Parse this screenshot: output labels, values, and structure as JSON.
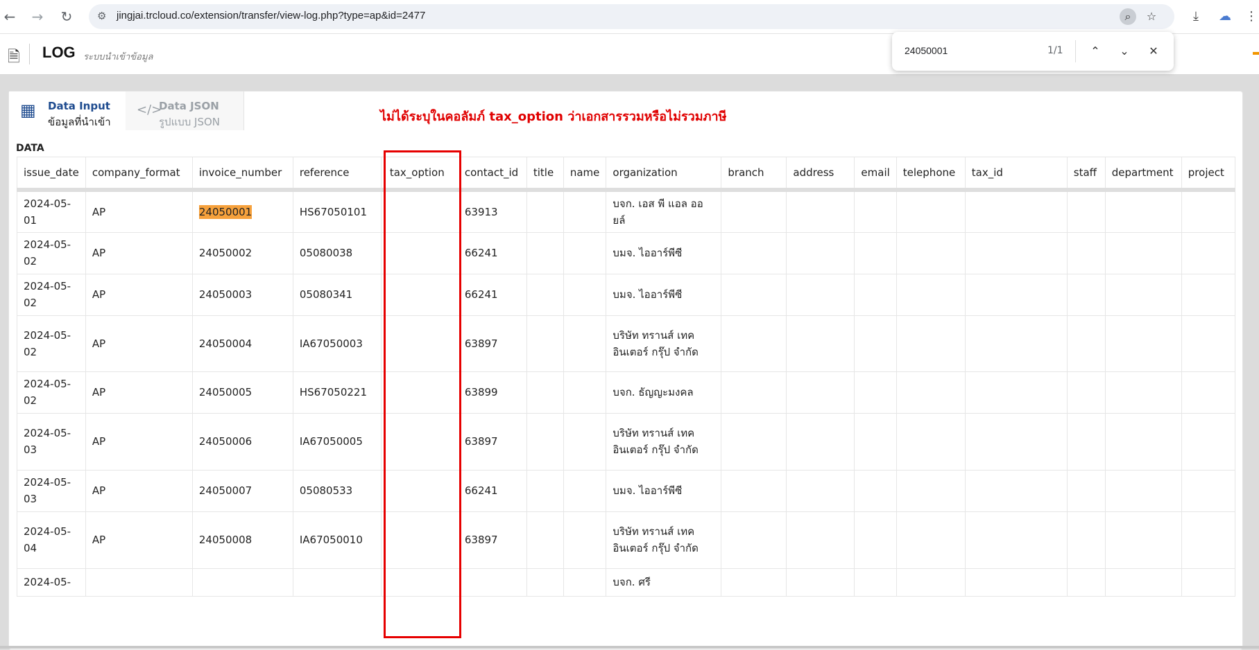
{
  "browser": {
    "url": "jingjai.trcloud.co/extension/transfer/view-log.php?type=ap&id=2477",
    "icons": [
      "back-arrow-icon",
      "forward-arrow-icon",
      "reload-icon",
      "site-info-icon",
      "page-search-icon",
      "star-icon",
      "download-icon",
      "cloud-icon",
      "more-vert-icon"
    ],
    "glyphs": {
      "back": "←",
      "forward": "→",
      "reload": "↻",
      "site": "⚙",
      "page_search": "⌕",
      "star": "☆",
      "download": "⤓",
      "cloud": "☁",
      "more": "⋮"
    }
  },
  "findbar": {
    "query": "24050001",
    "count": "1/1",
    "glyphs": {
      "up": "⌃",
      "down": "⌄",
      "close": "✕"
    }
  },
  "header": {
    "title": "LOG",
    "subtitle": "ระบบนำเข้าข้อมูล",
    "icon": "document-icon"
  },
  "tabs": [
    {
      "title": "Data Input",
      "subtitle": "ข้อมูลที่นำเข้า",
      "icon": "table-icon",
      "glyph": "▦"
    },
    {
      "title": "Data JSON",
      "subtitle": "รูปแบบ JSON",
      "icon": "code-icon",
      "glyph": "</>"
    }
  ],
  "annotation": "ไม่ได้ระบุในคอลัมภ์ tax_option ว่าเอกสารรวมหรือไม่รวมภาษี",
  "section_label": "DATA",
  "accent_color": "#1e4b8f",
  "highlight_color": "#f6a13c",
  "annotation_color": "#e60000",
  "table": {
    "columns": [
      "issue_date",
      "company_format",
      "invoice_number",
      "reference",
      "tax_option",
      "contact_id",
      "title",
      "name",
      "organization",
      "branch",
      "address",
      "email",
      "telephone",
      "tax_id",
      "staff",
      "department",
      "project"
    ],
    "rows": [
      {
        "issue_date": "2024-05-01",
        "company_format": "AP",
        "invoice_number": "24050001",
        "reference": "HS67050101",
        "contact_id": "63913",
        "organization": "บจก. เอส พี แอล ออยล์"
      },
      {
        "issue_date": "2024-05-02",
        "company_format": "AP",
        "invoice_number": "24050002",
        "reference": "05080038",
        "contact_id": "66241",
        "organization": "บมจ. ไออาร์พีซี"
      },
      {
        "issue_date": "2024-05-02",
        "company_format": "AP",
        "invoice_number": "24050003",
        "reference": "05080341",
        "contact_id": "66241",
        "organization": "บมจ. ไออาร์พีซี"
      },
      {
        "issue_date": "2024-05-02",
        "company_format": "AP",
        "invoice_number": "24050004",
        "reference": "IA67050003",
        "contact_id": "63897",
        "organization": "บริษัท ทรานส์ เทค อินเตอร์ กรุ๊ป จำกัด"
      },
      {
        "issue_date": "2024-05-02",
        "company_format": "AP",
        "invoice_number": "24050005",
        "reference": "HS67050221",
        "contact_id": "63899",
        "organization": "บจก. ธัญญะมงคล"
      },
      {
        "issue_date": "2024-05-03",
        "company_format": "AP",
        "invoice_number": "24050006",
        "reference": "IA67050005",
        "contact_id": "63897",
        "organization": "บริษัท ทรานส์ เทค อินเตอร์ กรุ๊ป จำกัด"
      },
      {
        "issue_date": "2024-05-03",
        "company_format": "AP",
        "invoice_number": "24050007",
        "reference": "05080533",
        "contact_id": "66241",
        "organization": "บมจ. ไออาร์พีซี"
      },
      {
        "issue_date": "2024-05-04",
        "company_format": "AP",
        "invoice_number": "24050008",
        "reference": "IA67050010",
        "contact_id": "63897",
        "organization": "บริษัท ทรานส์ เทค อินเตอร์ กรุ๊ป จำกัด"
      },
      {
        "issue_date": "2024-05-",
        "company_format": "",
        "invoice_number": "",
        "reference": "",
        "contact_id": "",
        "organization": "บจก. ศรี"
      }
    ]
  }
}
